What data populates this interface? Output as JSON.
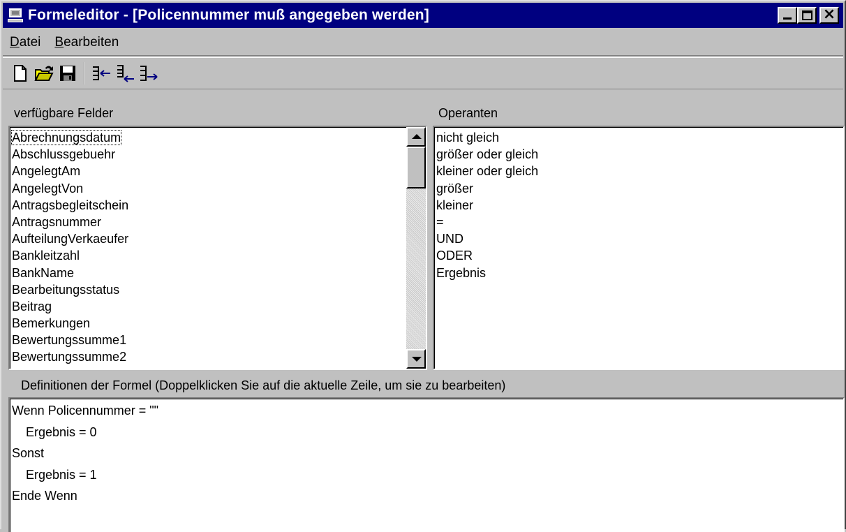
{
  "window": {
    "title": "Formeleditor - [Policennummer muß angegeben werden]"
  },
  "menubar": {
    "items": [
      {
        "underline": "D",
        "rest": "atei"
      },
      {
        "underline": "B",
        "rest": "earbeiten"
      }
    ]
  },
  "toolbar": {
    "icons": [
      "new-document-icon",
      "open-folder-icon",
      "save-disk-icon",
      "insert-field-icon",
      "remove-field-icon",
      "append-field-icon"
    ]
  },
  "fields_panel": {
    "label": "verfügbare Felder",
    "items": [
      "Abrechnungsdatum",
      "Abschlussgebuehr",
      "AngelegtAm",
      "AngelegtVon",
      "Antragsbegleitschein",
      "Antragsnummer",
      "AufteilungVerkaeufer",
      "Bankleitzahl",
      "BankName",
      "Bearbeitungsstatus",
      "Beitrag",
      "Bemerkungen",
      "Bewertungssumme1",
      "Bewertungssumme2"
    ]
  },
  "operands_panel": {
    "label": "Operanten",
    "items": [
      "nicht gleich",
      "größer oder gleich",
      "kleiner oder gleich",
      "größer",
      "kleiner",
      "=",
      "UND",
      "ODER",
      "Ergebnis"
    ]
  },
  "formula_panel": {
    "label": "Definitionen der Formel (Doppelklicken Sie auf die aktuelle Zeile, um sie zu bearbeiten)",
    "lines": [
      "Wenn Policennummer = \"\"",
      "    Ergebnis = 0",
      "Sonst",
      "    Ergebnis = 1",
      "Ende Wenn"
    ]
  }
}
